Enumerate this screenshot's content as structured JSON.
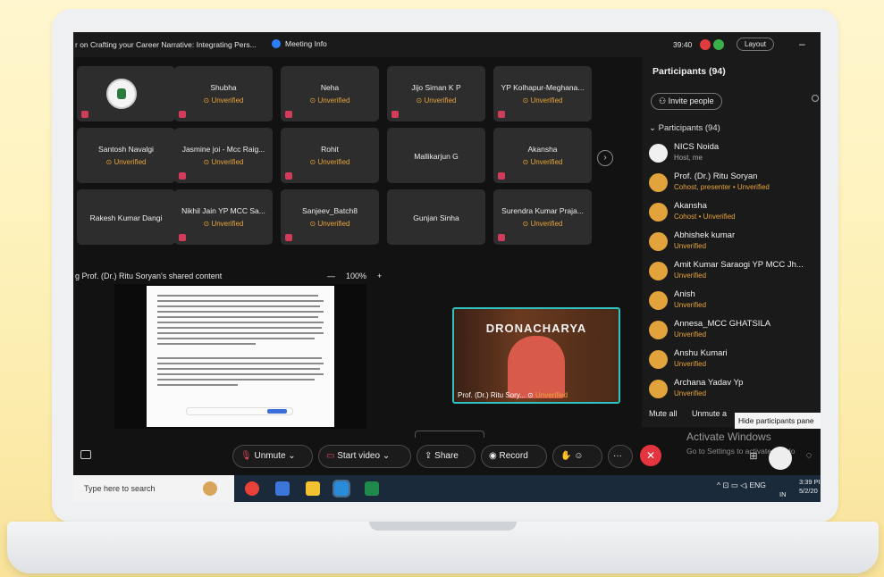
{
  "window": {
    "title": "r on Crafting your Career Narrative: Integrating Pers...",
    "meeting_info": "Meeting Info",
    "timer": "39:40",
    "layout": "Layout",
    "minimize": "–"
  },
  "tiles": [
    {
      "name": "",
      "status": ""
    },
    {
      "name": "Shubha",
      "status": "Unverified"
    },
    {
      "name": "Neha",
      "status": "Unverified"
    },
    {
      "name": "Jijo Siman K P",
      "status": "Unverified"
    },
    {
      "name": "YP Kolhapur-Meghana...",
      "status": "Unverified"
    },
    {
      "name": "Santosh Navalgi",
      "status": "Unverified"
    },
    {
      "name": "Jasmine joi - Mcc Raig...",
      "status": "Unverified"
    },
    {
      "name": "Rohit",
      "status": "Unverified"
    },
    {
      "name": "Mallikarjun G",
      "status": ""
    },
    {
      "name": "Akansha",
      "status": "Unverified"
    },
    {
      "name": "Rakesh Kumar Dangi",
      "status": ""
    },
    {
      "name": "Nikhil Jain YP MCC Sa...",
      "status": "Unverified"
    },
    {
      "name": "Sanjeev_Batch8",
      "status": "Unverified"
    },
    {
      "name": "Gunjan Sinha",
      "status": ""
    },
    {
      "name": "Surendra Kumar Praja...",
      "status": "Unverified"
    }
  ],
  "next_arrow": "›",
  "share": {
    "label": "g Prof. (Dr.) Ritu Soryan's shared content",
    "zoom_out": "—",
    "zoom": "100%",
    "zoom_in": "+"
  },
  "video": {
    "banner": "DRONACHARYA",
    "caption_name": "Prof. (Dr.) Ritu Sory...",
    "caption_status": "Unverified"
  },
  "controls": {
    "unmute": "Unmute",
    "start_video": "Start video",
    "share": "Share",
    "record": "Record",
    "more": "···",
    "end": "✕"
  },
  "panel": {
    "title": "Participants (94)",
    "invite": "Invite people",
    "section": "Participants (94)",
    "people": [
      {
        "name": "NICS Noida",
        "status": "Host, me"
      },
      {
        "name": "Prof. (Dr.) Ritu Soryan",
        "status": "Cohost, presenter • Unverified"
      },
      {
        "name": "Akansha",
        "status": "Cohost • Unverified"
      },
      {
        "name": "Abhishek kumar",
        "status": "Unverified"
      },
      {
        "name": "Amit Kumar Saraogi YP MCC Jh...",
        "status": "Unverified"
      },
      {
        "name": "Anish",
        "status": "Unverified"
      },
      {
        "name": "Annesa_MCC GHATSILA",
        "status": "Unverified"
      },
      {
        "name": "Anshu Kumari",
        "status": "Unverified"
      },
      {
        "name": "Archana Yadav Yp",
        "status": "Unverified"
      }
    ],
    "mute_all": "Mute all",
    "unmute_all": "Unmute a",
    "tooltip": "Hide participants pane"
  },
  "watermark": {
    "line1": "Activate Windows",
    "line2": "Go to Settings to activate Windo"
  },
  "taskbar": {
    "search": "Type here to search",
    "lang": "ENG",
    "region": "IN",
    "time": "3:39 PI",
    "date": "5/2/20"
  },
  "colors": {
    "accent": "#2d7ff9",
    "unverified": "#e8a43a",
    "end_call": "#e3343f",
    "video_border": "#2fc2c2"
  }
}
